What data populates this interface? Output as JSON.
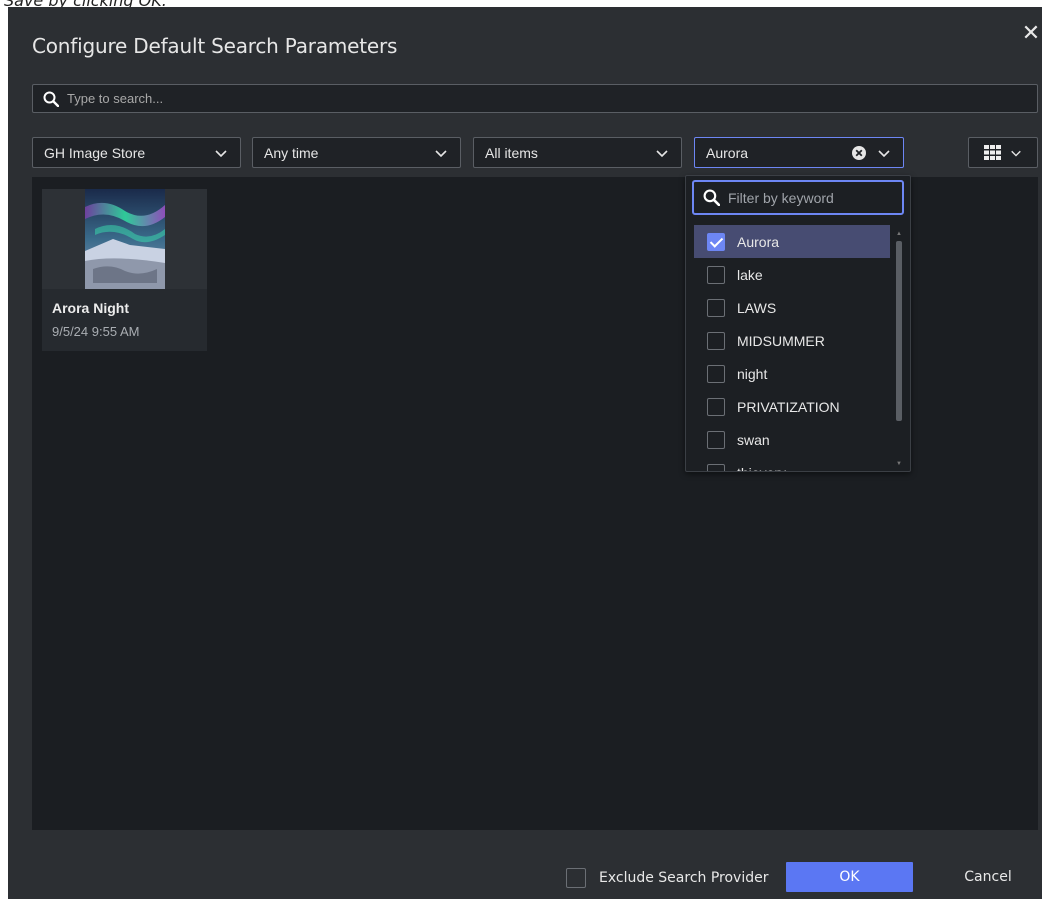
{
  "background_text": "Save by clicking OK.",
  "dialog": {
    "title": "Configure Default Search Parameters",
    "close_icon": "close-icon"
  },
  "search": {
    "placeholder": "Type to search...",
    "icon": "search-icon"
  },
  "filters": {
    "source": "GH Image Store",
    "time": "Any time",
    "items": "All items",
    "keyword": "Aurora"
  },
  "view_toggle": {
    "icon": "grid-icon"
  },
  "results": [
    {
      "title": "Arora Night",
      "date": "9/5/24 9:55 AM"
    }
  ],
  "keyword_popup": {
    "filter_placeholder": "Filter by keyword",
    "items": [
      {
        "label": "Aurora",
        "checked": true
      },
      {
        "label": "lake",
        "checked": false
      },
      {
        "label": "LAWS",
        "checked": false
      },
      {
        "label": "MIDSUMMER",
        "checked": false
      },
      {
        "label": "night",
        "checked": false
      },
      {
        "label": "PRIVATIZATION",
        "checked": false
      },
      {
        "label": "swan",
        "checked": false
      },
      {
        "label": "thievery",
        "checked": false
      }
    ]
  },
  "footer": {
    "exclude_label": "Exclude Search Provider",
    "ok_label": "OK",
    "cancel_label": "Cancel"
  },
  "colors": {
    "accent": "#5b77f3",
    "dialog_bg": "#2c2f33",
    "selected_row": "#474c72"
  }
}
